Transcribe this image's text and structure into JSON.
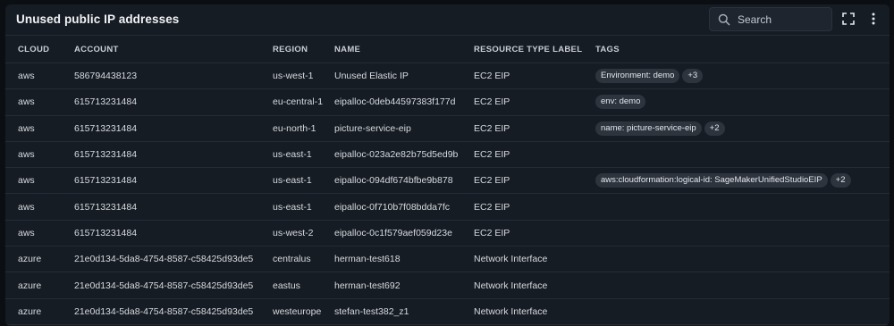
{
  "header": {
    "title": "Unused public IP addresses",
    "search_placeholder": "Search"
  },
  "icons": {
    "search": "search-icon",
    "fullscreen": "fullscreen-icon",
    "more": "more-vertical-icon"
  },
  "table": {
    "columns": [
      "CLOUD",
      "ACCOUNT",
      "REGION",
      "NAME",
      "RESOURCE TYPE LABEL",
      "TAGS"
    ],
    "rows": [
      {
        "cloud": "aws",
        "account": "586794438123",
        "region": "us-west-1",
        "name": "Unused Elastic IP",
        "type": "EC2 EIP",
        "tags": [
          "Environment: demo",
          "+3"
        ]
      },
      {
        "cloud": "aws",
        "account": "615713231484",
        "region": "eu-central-1",
        "name": "eipalloc-0deb44597383f177d",
        "type": "EC2 EIP",
        "tags": [
          "env: demo"
        ]
      },
      {
        "cloud": "aws",
        "account": "615713231484",
        "region": "eu-north-1",
        "name": "picture-service-eip",
        "type": "EC2 EIP",
        "tags": [
          "name: picture-service-eip",
          "+2"
        ]
      },
      {
        "cloud": "aws",
        "account": "615713231484",
        "region": "us-east-1",
        "name": "eipalloc-023a2e82b75d5ed9b",
        "type": "EC2 EIP",
        "tags": []
      },
      {
        "cloud": "aws",
        "account": "615713231484",
        "region": "us-east-1",
        "name": "eipalloc-094df674bfbe9b878",
        "type": "EC2 EIP",
        "tags": [
          "aws:cloudformation:logical-id: SageMakerUnifiedStudioEIP",
          "+2"
        ]
      },
      {
        "cloud": "aws",
        "account": "615713231484",
        "region": "us-east-1",
        "name": "eipalloc-0f710b7f08bdda7fc",
        "type": "EC2 EIP",
        "tags": []
      },
      {
        "cloud": "aws",
        "account": "615713231484",
        "region": "us-west-2",
        "name": "eipalloc-0c1f579aef059d23e",
        "type": "EC2 EIP",
        "tags": []
      },
      {
        "cloud": "azure",
        "account": "21e0d134-5da8-4754-8587-c58425d93de5",
        "region": "centralus",
        "name": "herman-test618",
        "type": "Network Interface",
        "tags": []
      },
      {
        "cloud": "azure",
        "account": "21e0d134-5da8-4754-8587-c58425d93de5",
        "region": "eastus",
        "name": "herman-test692",
        "type": "Network Interface",
        "tags": []
      },
      {
        "cloud": "azure",
        "account": "21e0d134-5da8-4754-8587-c58425d93de5",
        "region": "westeurope",
        "name": "stefan-test382_z1",
        "type": "Network Interface",
        "tags": []
      }
    ]
  }
}
